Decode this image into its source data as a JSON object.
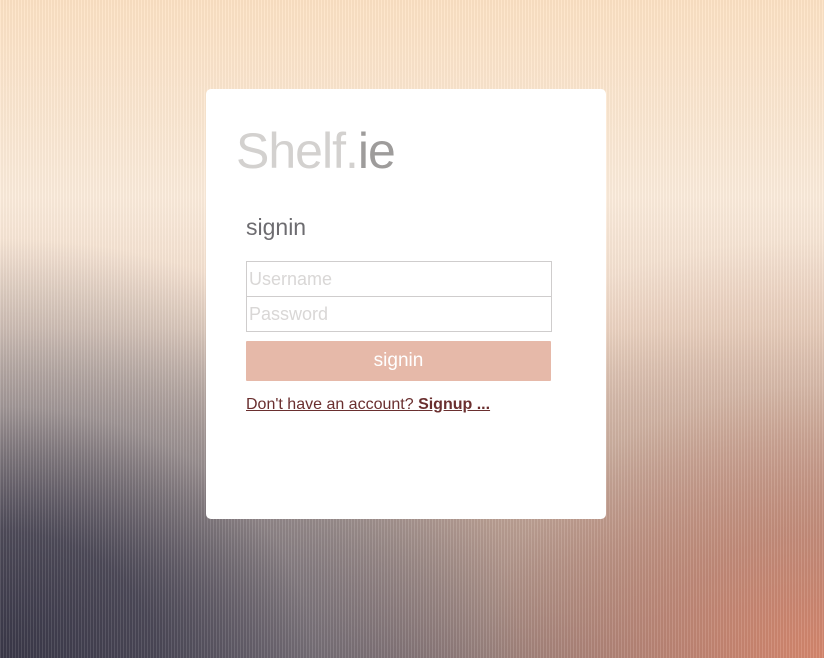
{
  "logo": {
    "part1": "Shelf.",
    "part2": "ie"
  },
  "form": {
    "title": "signin",
    "username_placeholder": "Username",
    "password_placeholder": "Password",
    "submit_label": "signin"
  },
  "signup": {
    "prompt": "Don't have an account? ",
    "link": "Signup ..."
  },
  "colors": {
    "button": "#e6b9a9",
    "link": "#6a2f2f",
    "title": "#6d6c70"
  }
}
